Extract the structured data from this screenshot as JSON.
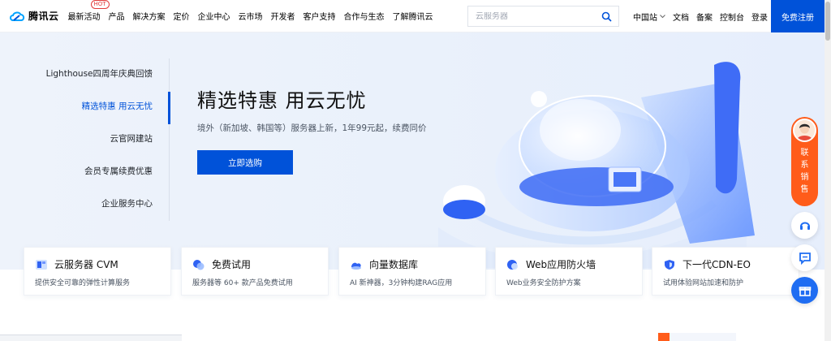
{
  "header": {
    "logo_text": "腾讯云",
    "nav": [
      {
        "label": "最新活动",
        "badge": "HOT"
      },
      {
        "label": "产品"
      },
      {
        "label": "解决方案"
      },
      {
        "label": "定价"
      },
      {
        "label": "企业中心"
      },
      {
        "label": "云市场"
      },
      {
        "label": "开发者"
      },
      {
        "label": "客户支持"
      },
      {
        "label": "合作与生态"
      },
      {
        "label": "了解腾讯云"
      }
    ],
    "search_placeholder": "云服务器",
    "right_nav": [
      "中国站",
      "文档",
      "备案",
      "控制台",
      "登录"
    ],
    "register_label": "免费注册"
  },
  "hero": {
    "tabs": [
      "Lighthouse四周年庆典回馈",
      "精选特惠 用云无忧",
      "云官网建站",
      "会员专属续费优惠",
      "企业服务中心"
    ],
    "active_tab": 1,
    "title": "精选特惠 用云无忧",
    "subtitle": "境外（新加坡、韩国等）服务器上新，1年99元起，续费同价",
    "button_label": "立即选购"
  },
  "cards": [
    {
      "title": "云服务器 CVM",
      "desc": "提供安全可靠的弹性计算服务"
    },
    {
      "title": "免费试用",
      "desc": "服务器等 60+ 款产品免费试用"
    },
    {
      "title": "向量数据库",
      "desc": "AI 新神器，3分钟构建RAG应用"
    },
    {
      "title": "Web应用防火墙",
      "desc": "Web业务安全防护方案"
    },
    {
      "title": "下一代CDN-EO",
      "desc": "试用体验网站加速和防护"
    }
  ],
  "float": {
    "contact_label": "联系销售"
  },
  "colors": {
    "brand": "#0052d9",
    "contact": "#ff5c1a"
  }
}
